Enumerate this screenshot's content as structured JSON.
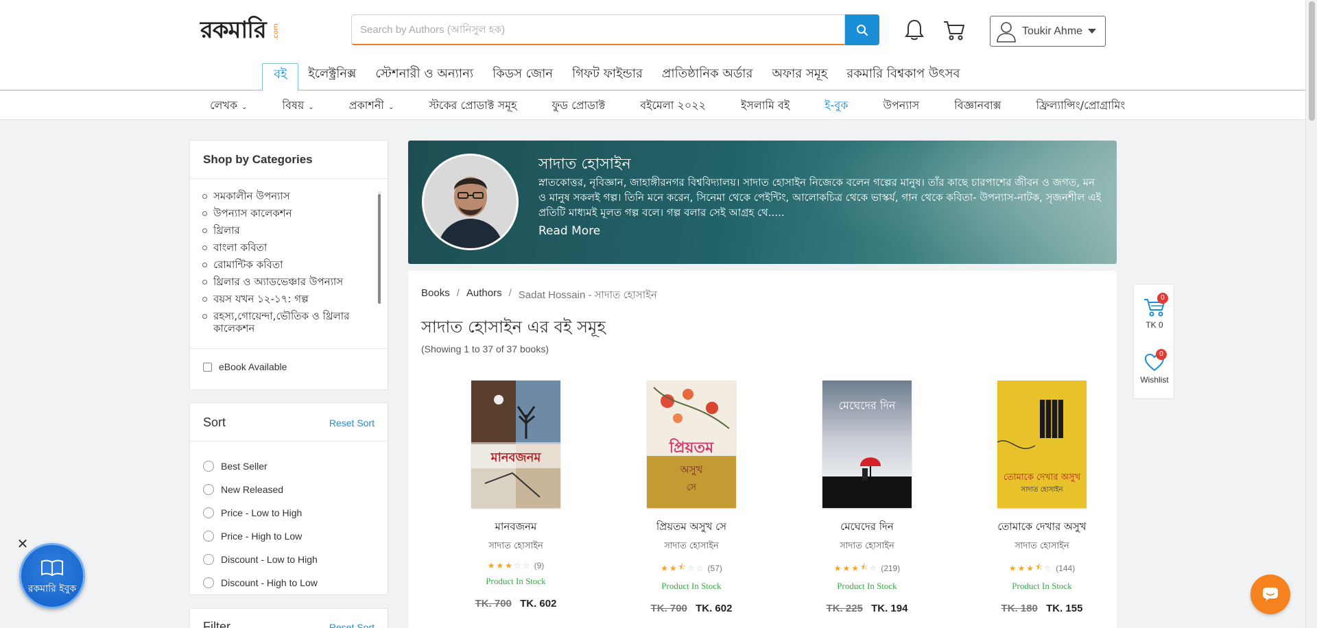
{
  "header": {
    "logo_text": "রকমারি",
    "logo_suffix": ".com",
    "search_placeholder": "Search by Authors (আনিসুল হক)",
    "user_name": "Toukir Ahmed"
  },
  "main_nav": [
    "বই",
    "ইলেক্ট্রনিক্স",
    "স্টেশনারী ও অন্যান্য",
    "কিডস জোন",
    "গিফট ফাইন্ডার",
    "প্রাতিষ্ঠানিক অর্ডার",
    "অফার সমূহ",
    "রকমারি বিশ্বকাপ উৎসব"
  ],
  "sub_nav": [
    {
      "label": "লেখক",
      "dropdown": true
    },
    {
      "label": "বিষয়",
      "dropdown": true
    },
    {
      "label": "প্রকাশনী",
      "dropdown": true
    },
    {
      "label": "স্টকের প্রোডাক্ট সমূহ",
      "dropdown": false
    },
    {
      "label": "ফুড প্রোডাক্ট",
      "dropdown": false
    },
    {
      "label": "বইমেলা ২০২২",
      "dropdown": false
    },
    {
      "label": "ইসলামি বই",
      "dropdown": false
    },
    {
      "label": "ই-বুক",
      "dropdown": false
    },
    {
      "label": "উপন্যাস",
      "dropdown": false
    },
    {
      "label": "বিজ্ঞানবাক্স",
      "dropdown": false
    },
    {
      "label": "ফ্রিল্যান্সিং/প্রোগ্রামিং",
      "dropdown": false
    }
  ],
  "categories": {
    "title": "Shop by Categories",
    "items": [
      "সমকালীন উপন্যাস",
      "উপন্যাস কালেকশন",
      "থ্রিলার",
      "বাংলা কবিতা",
      "রোমান্টিক কবিতা",
      "থ্রিলার ও অ্যাডভেঞ্চার উপন্যাস",
      "বয়স যখন ১২-১৭: গল্প",
      "রহস্য,গোয়েন্দা,ভৌতিক ও থ্রিলার কালেকশন"
    ],
    "ebook_label": "eBook Available"
  },
  "sort": {
    "title": "Sort",
    "reset": "Reset Sort",
    "options": [
      "Best Seller",
      "New Released",
      "Price - Low to High",
      "Price - High to Low",
      "Discount - Low to High",
      "Discount - High to Low"
    ]
  },
  "filter": {
    "title": "Filter",
    "reset": "Reset Sort"
  },
  "author": {
    "name": "সাদাত হোসাইন",
    "bio": "স্নাতকোত্তর, নৃবিজ্ঞান, জাহাঙ্গীরনগর বিশ্ববিদ্যালয়। সাদাত হোসাইন নিজেকে বলেন গল্পের মানুষ। তাঁর কাছে চারপাশের জীবন ও জগত, মন ও মানুষ সকলই গল্প। তিনি মনে করেন, সিনেমা থেকে পেইন্টিং, আলোকচিত্র থেকে ভাস্কর্য, গান থেকে কবিতা- উপন্যাস-নাটক, সৃজনশীল এই প্রতিটি মাধ্যমই মূলত গল্প বলে। গল্প বলার সেই আগ্রহ থে.....",
    "read_more": "Read More"
  },
  "breadcrumb": {
    "books": "Books",
    "authors": "Authors",
    "current": "Sadat Hossain - সাদাত হোসাইন"
  },
  "listing": {
    "title": "সাদাত হোসাইন এর বই সমূহ",
    "showing": "(Showing 1 to 37 of 37 books)"
  },
  "books": [
    {
      "title": "মানবজনম",
      "author": "সাদাত হোসাইন",
      "rating": 3,
      "reviews": "(9)",
      "stock": "Product In Stock",
      "old_price": "TK. 700",
      "price": "TK. 602"
    },
    {
      "title": "প্রিয়তম অসুখ সে",
      "author": "সাদাত হোসাইন",
      "rating": 2.5,
      "reviews": "(57)",
      "stock": "Product In Stock",
      "old_price": "TK. 700",
      "price": "TK. 602"
    },
    {
      "title": "মেঘেদের দিন",
      "author": "সাদাত হোসাইন",
      "rating": 3.5,
      "reviews": "(219)",
      "stock": "Product In Stock",
      "old_price": "TK. 225",
      "price": "TK. 194"
    },
    {
      "title": "তোমাকে দেখার অসুখ",
      "author": "সাদাত হোসাইন",
      "rating": 3.5,
      "reviews": "(144)",
      "stock": "Product In Stock",
      "old_price": "TK. 180",
      "price": "TK. 155"
    }
  ],
  "float_widget": {
    "cart_badge": "0",
    "cart_label": "TK 0",
    "wishlist_badge": "0",
    "wishlist_label": "Wishlist"
  },
  "ebook_bubble": {
    "label": "রকমারি ইবুক",
    "close": "✕"
  },
  "colors": {
    "accent_blue": "#1a8fd8",
    "accent_orange": "#f47b20",
    "stock_green": "#3aa84a",
    "badge_red": "#e53935"
  }
}
